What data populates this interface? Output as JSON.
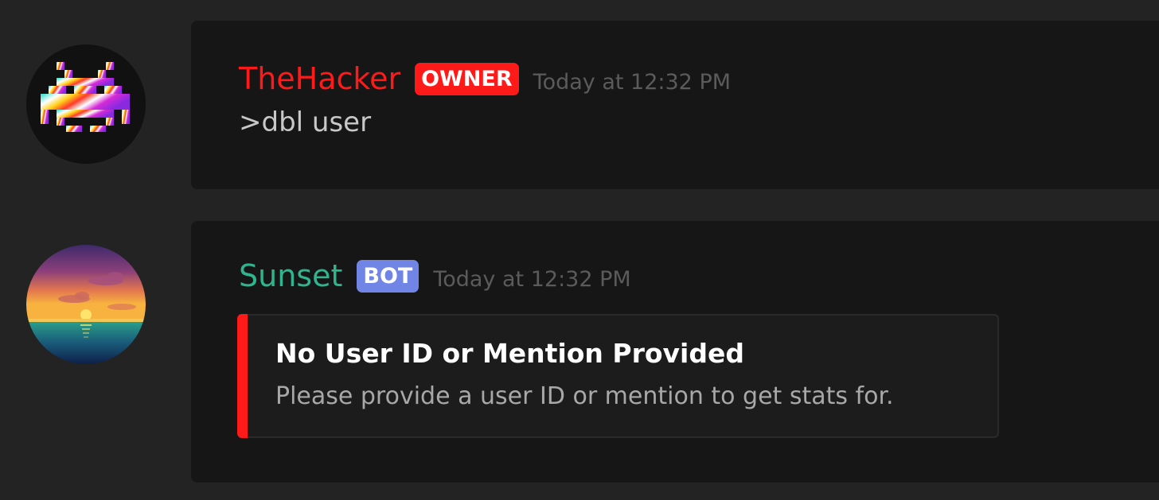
{
  "messages": [
    {
      "username": "TheHacker",
      "badge": "OWNER",
      "timestamp": "Today at 12:32 PM",
      "content": ">dbl user",
      "avatar_icon": "pixel-space-invader-icon",
      "name_color": "#ff1a1a",
      "badge_color": "#ff1a1a"
    },
    {
      "username": "Sunset",
      "badge": "BOT",
      "timestamp": "Today at 12:32 PM",
      "avatar_icon": "sunset-landscape-icon",
      "name_color": "#2fb58d",
      "badge_color": "#7185e6",
      "embed": {
        "title": "No User ID or Mention Provided",
        "description": "Please provide a user ID or mention to get stats for.",
        "accent_color": "#ff1a1a"
      }
    }
  ]
}
